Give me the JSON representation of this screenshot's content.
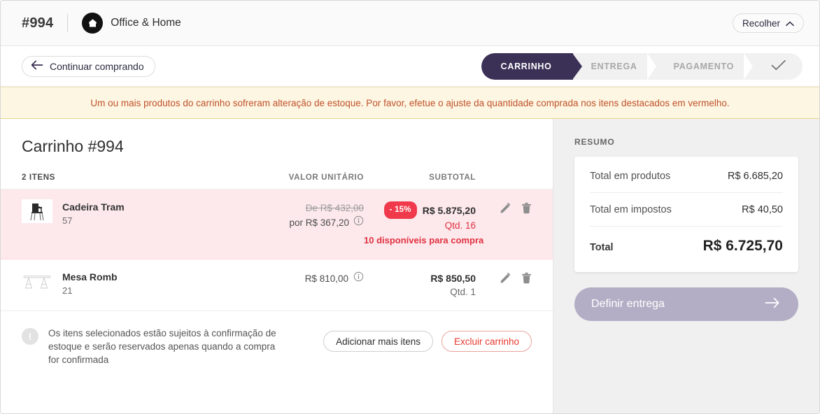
{
  "header": {
    "order_id": "#994",
    "brand_name": "Office & Home",
    "collapse_label": "Recolher"
  },
  "steps_bar": {
    "back_label": "Continuar comprando",
    "steps": [
      {
        "label": "CARRINHO",
        "active": true
      },
      {
        "label": "ENTREGA",
        "active": false
      },
      {
        "label": "PAGAMENTO",
        "active": false
      }
    ]
  },
  "warning": {
    "message": "Um ou mais produtos do carrinho sofreram alteração de estoque. Por favor, efetue o ajuste da quantidade comprada nos itens destacados em vermelho."
  },
  "cart": {
    "title": "Carrinho #994",
    "items_count_label": "2 ITENS",
    "columns": {
      "unit": "VALOR UNITÁRIO",
      "subtotal": "SUBTOTAL"
    },
    "items": [
      {
        "name": "Cadeira Tram",
        "sku": "57",
        "unit_from": "De R$ 432,00",
        "unit_to": "por R$ 367,20",
        "discount_badge": "- 15%",
        "subtotal": "R$ 5.875,20",
        "qty": "Qtd. 16",
        "stock_warning": "10 disponíveis para compra"
      },
      {
        "name": "Mesa Romb",
        "sku": "21",
        "unit_price": "R$ 810,00",
        "subtotal": "R$ 850,50",
        "qty": "Qtd. 1"
      }
    ],
    "footer_note": "Os itens selecionados estão sujeitos à confirmação de estoque e serão reservados apenas quando a compra for confirmada",
    "add_items_label": "Adicionar mais itens",
    "delete_cart_label": "Excluir carrinho"
  },
  "summary": {
    "title": "RESUMO",
    "rows": [
      {
        "label": "Total em produtos",
        "value": "R$ 6.685,20"
      },
      {
        "label": "Total em impostos",
        "value": "R$ 40,50"
      },
      {
        "label": "Total",
        "value": "R$ 6.725,70"
      }
    ],
    "cta_label": "Definir entrega"
  },
  "colors": {
    "accent_purple": "#3b3157",
    "danger_red": "#e0303f",
    "badge_red": "#f03a4b",
    "warning_bg": "#fdf6e3",
    "warning_text": "#c0522a",
    "alert_row_bg": "#fde9ec",
    "cta_disabled": "#b3aec5"
  }
}
